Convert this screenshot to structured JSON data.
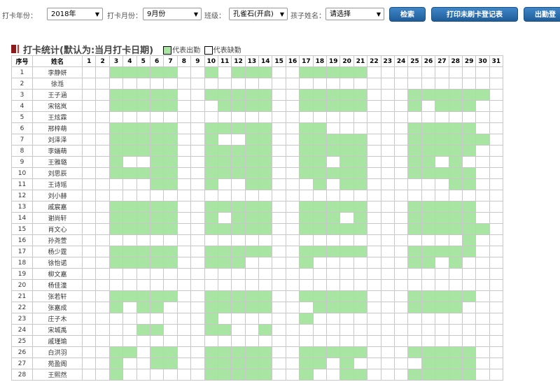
{
  "filters": {
    "year_label": "打卡年份：",
    "year_value": "2018年",
    "month_label": "打卡月份：",
    "month_value": "9月份",
    "class_label": "班级：",
    "class_value": "孔雀石(开启)",
    "child_label": "孩子姓名：",
    "child_value": "请选择"
  },
  "buttons": {
    "search": "检索",
    "print": "打印未刷卡登记表",
    "attendance": "出勤登"
  },
  "section": {
    "title": "打卡统计(默认为:当月打卡日期)",
    "legend_present": "代表出勤",
    "legend_absent": "代表缺勤"
  },
  "colors": {
    "present": "#a8e4a2",
    "button": "#2b6eb0",
    "title_marker": "#8e1b1b"
  },
  "table": {
    "col_index": "序号",
    "col_name": "姓名",
    "days": [
      "1",
      "2",
      "3",
      "4",
      "5",
      "6",
      "7",
      "8",
      "9",
      "10",
      "11",
      "12",
      "13",
      "14",
      "15",
      "16",
      "17",
      "18",
      "19",
      "20",
      "21",
      "22",
      "23",
      "24",
      "25",
      "26",
      "27",
      "28",
      "29",
      "30",
      "31"
    ],
    "rows": [
      {
        "index": "1",
        "name": "李静妍",
        "present": [
          3,
          4,
          5,
          6,
          7,
          10,
          12,
          13,
          14,
          17,
          18,
          19,
          20,
          21
        ]
      },
      {
        "index": "2",
        "name": "徐湉",
        "present": []
      },
      {
        "index": "3",
        "name": "王子涵",
        "present": [
          3,
          4,
          5,
          6,
          7,
          10,
          11,
          12,
          13,
          14,
          17,
          18,
          19,
          20,
          21,
          25,
          26,
          27,
          28,
          29,
          30
        ]
      },
      {
        "index": "4",
        "name": "宋铭岚",
        "present": [
          3,
          4,
          5,
          6,
          7,
          11,
          12,
          13,
          14,
          17,
          18,
          19,
          20,
          21,
          25,
          27,
          28,
          29
        ]
      },
      {
        "index": "5",
        "name": "王炫霖",
        "present": []
      },
      {
        "index": "6",
        "name": "邢梓萌",
        "present": [
          3,
          4,
          5,
          6,
          7,
          10,
          11,
          12,
          13,
          14,
          17,
          18,
          25,
          26,
          27,
          28,
          29
        ]
      },
      {
        "index": "7",
        "name": "刘泽泽",
        "present": [
          3,
          4,
          5,
          6,
          7,
          10,
          13,
          14,
          17,
          18,
          19,
          20,
          21,
          25,
          26,
          27,
          28,
          29,
          30
        ]
      },
      {
        "index": "8",
        "name": "李婳萌",
        "present": [
          3,
          4,
          5,
          6,
          7,
          10,
          11,
          12,
          13,
          14,
          17,
          18,
          19,
          20,
          21,
          25,
          26,
          27,
          28,
          29
        ]
      },
      {
        "index": "9",
        "name": "王雅璐",
        "present": [
          3,
          6,
          7,
          10,
          11,
          12,
          13,
          14,
          17,
          18,
          20,
          21,
          25,
          26,
          28
        ]
      },
      {
        "index": "10",
        "name": "刘思辰",
        "present": [
          3,
          4,
          5,
          6,
          7,
          10,
          11,
          12,
          13,
          14,
          17,
          18,
          19,
          20,
          21,
          25,
          26,
          27,
          28,
          29
        ]
      },
      {
        "index": "11",
        "name": "王诗瑶",
        "present": [
          6,
          7,
          10,
          13,
          14,
          18,
          20,
          21,
          28,
          29
        ]
      },
      {
        "index": "12",
        "name": "刘小赫",
        "present": []
      },
      {
        "index": "13",
        "name": "戚宸嘉",
        "present": [
          3,
          4,
          5,
          6,
          7,
          10,
          11,
          12,
          13,
          14,
          17,
          18,
          19,
          20,
          21,
          25,
          26,
          27,
          28,
          29
        ]
      },
      {
        "index": "14",
        "name": "谢尚轩",
        "present": [
          3,
          4,
          5,
          6,
          7,
          10,
          12,
          13,
          14,
          17,
          18,
          19,
          21,
          25,
          26,
          27,
          28,
          29
        ]
      },
      {
        "index": "15",
        "name": "肖文心",
        "present": [
          3,
          4,
          5,
          6,
          7,
          10,
          11,
          12,
          13,
          14,
          17,
          18,
          19,
          20,
          21,
          25,
          26,
          27,
          28,
          29,
          30
        ]
      },
      {
        "index": "16",
        "name": "孙尧萱",
        "present": [
          29
        ]
      },
      {
        "index": "17",
        "name": "杨少霆",
        "present": [
          3,
          4,
          5,
          6,
          7,
          10,
          11,
          12,
          13,
          14,
          17,
          18,
          19,
          20,
          21,
          25,
          26,
          27,
          28,
          29
        ]
      },
      {
        "index": "18",
        "name": "徐怡诺",
        "present": [
          3,
          4,
          5,
          6,
          7,
          10,
          11,
          12,
          17,
          25,
          26,
          28
        ]
      },
      {
        "index": "19",
        "name": "柳文嘉",
        "present": []
      },
      {
        "index": "20",
        "name": "杨佳潼",
        "present": []
      },
      {
        "index": "21",
        "name": "张若轩",
        "present": [
          3,
          4,
          5,
          6,
          7,
          10,
          11,
          12,
          13,
          14,
          17,
          18,
          19,
          20,
          21,
          25,
          26,
          27,
          28,
          29
        ]
      },
      {
        "index": "22",
        "name": "张嘉成",
        "present": [
          3,
          5,
          6,
          10,
          11,
          12,
          13,
          14,
          18,
          19,
          20,
          21,
          25,
          26,
          27,
          28
        ]
      },
      {
        "index": "23",
        "name": "庄子木",
        "present": [
          10,
          17
        ]
      },
      {
        "index": "24",
        "name": "宋城禹",
        "present": [
          5,
          6,
          10,
          11,
          14
        ]
      },
      {
        "index": "25",
        "name": "戚瑾瑜",
        "present": []
      },
      {
        "index": "26",
        "name": "白洪羽",
        "present": [
          3,
          4,
          6,
          7,
          10,
          11,
          12,
          13,
          14,
          17,
          18,
          19,
          20,
          21,
          25,
          26,
          27,
          28,
          29
        ]
      },
      {
        "index": "27",
        "name": "苑盈阁",
        "present": [
          3,
          6,
          7,
          10,
          11,
          12,
          13,
          14,
          17,
          18,
          20,
          26,
          27,
          28,
          29
        ]
      },
      {
        "index": "28",
        "name": "王熙然",
        "present": [
          3,
          10,
          11,
          12,
          13,
          14,
          17,
          20,
          21,
          25,
          26,
          27,
          28,
          29
        ]
      }
    ]
  }
}
